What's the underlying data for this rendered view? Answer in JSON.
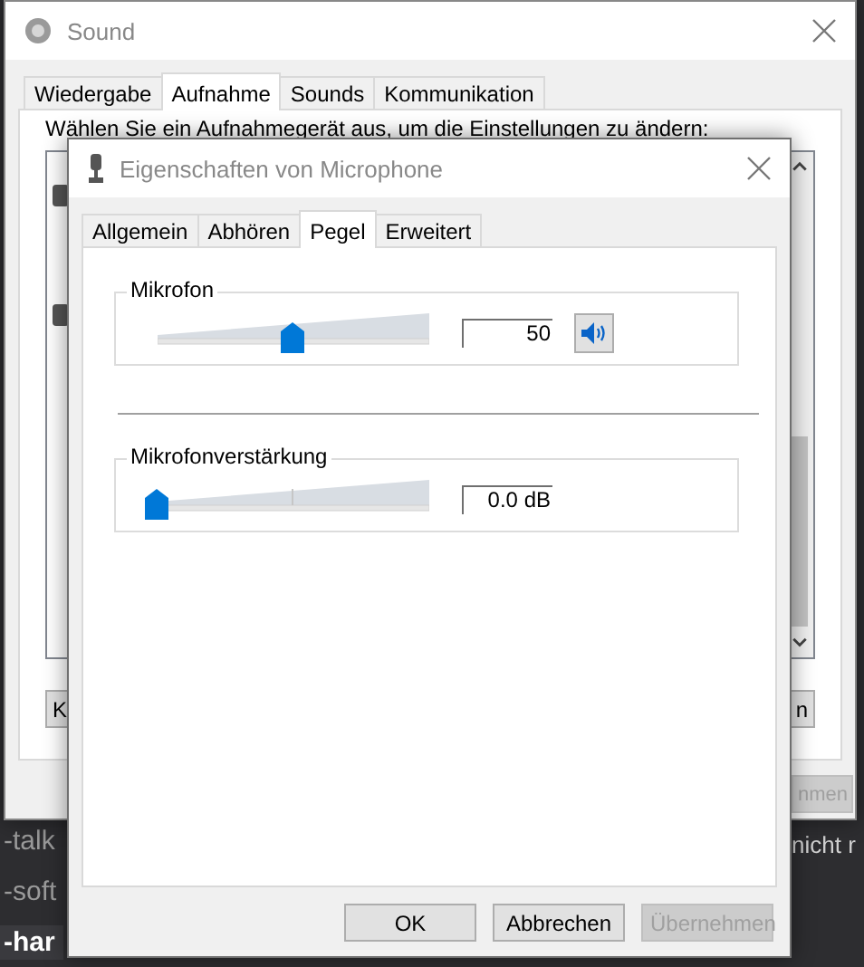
{
  "desktop": {
    "sidebar_items": [
      {
        "label": "-talk",
        "selected": false
      },
      {
        "label": "-soft",
        "selected": false
      },
      {
        "label": "-har",
        "selected": true
      }
    ],
    "post_fragment": "nicht r"
  },
  "sound_window": {
    "title": "Sound",
    "tabs": [
      {
        "label": "Wiedergabe",
        "selected": false
      },
      {
        "label": "Aufnahme",
        "selected": true
      },
      {
        "label": "Sounds",
        "selected": false
      },
      {
        "label": "Kommunikation",
        "selected": false
      }
    ],
    "instruction": "Wählen Sie ein Aufnahmegerät aus, um die Einstellungen zu ändern:",
    "list_buttons": [
      {
        "label": "K",
        "disabled": false
      },
      {
        "label": "n",
        "disabled": false
      }
    ],
    "footer_buttons": [
      {
        "label": "nmen",
        "disabled": true
      }
    ]
  },
  "dialog": {
    "title": "Eigenschaften von Microphone",
    "tabs": [
      {
        "label": "Allgemein",
        "selected": false
      },
      {
        "label": "Abhören",
        "selected": false
      },
      {
        "label": "Pegel",
        "selected": true
      },
      {
        "label": "Erweitert",
        "selected": false
      }
    ],
    "groups": [
      {
        "label": "Mikrofon",
        "level": 0.5,
        "reading": "50",
        "mute_button": true,
        "center_tick": false
      },
      {
        "label": "Mikrofonverstärkung",
        "level": 0,
        "reading": "0.0 dB",
        "mute_button": false,
        "center_tick": true
      }
    ],
    "buttons": [
      {
        "label": "OK",
        "disabled": false
      },
      {
        "label": "Abbrechen",
        "disabled": false
      },
      {
        "label": "Übernehmen",
        "disabled": true
      }
    ]
  }
}
